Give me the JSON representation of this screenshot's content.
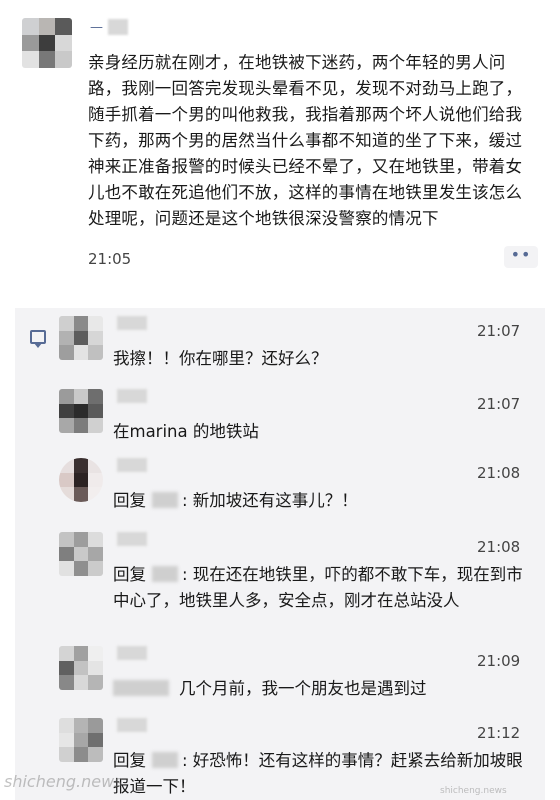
{
  "post": {
    "text": "亲身经历就在刚才，在地铁被下迷药，两个年轻的男人问路，我刚一回答完发现头晕看不见，发现不对劲马上跑了，随手抓着一个男的叫他救我，我指着那两个坏人说他们给我下药，那两个男的居然当什么事都不知道的坐了下来，缓过神来正准备报警的时候头已经不晕了，又在地铁里，带着女儿也不敢在死追他们不放，这样的事情在地铁里发生该怎么处理呢，问题还是这个地铁很深没警察的情况下",
    "time": "21:05",
    "more_label": "••",
    "avatar_colors": [
      "#cfd0d2",
      "#b9b6b3",
      "#5a5a5a",
      "#9a9a9a",
      "#3d3d3d",
      "#d8d8d8",
      "#e2e2e2",
      "#787878",
      "#c9c9c9"
    ]
  },
  "comments": [
    {
      "time": "21:07",
      "text": "我擦！！你在哪里？还好么？",
      "avatar_colors": [
        "#cfcfcf",
        "#8a8a8a",
        "#e8e8e8",
        "#b2b2b2",
        "#5d5d5d",
        "#d6d6d6",
        "#9e9e9e",
        "#e3e3e3",
        "#c0c0c0"
      ]
    },
    {
      "time": "21:07",
      "text": "在marina 的地铁站",
      "avatar_colors": [
        "#9b9b9b",
        "#c9c9c9",
        "#6e6e6e",
        "#404040",
        "#2b2b2b",
        "#5a5a5a",
        "#a8a8a8",
        "#7c7c7c",
        "#d0d0d0"
      ]
    },
    {
      "time": "21:08",
      "text_prefix": "回复",
      "text": ": 新加坡还有这事儿？！",
      "avatar_colors": [
        "#e6dede",
        "#3a2f2f",
        "#e9e3e3",
        "#d9c9c6",
        "#2c2323",
        "#f0ebeb",
        "#e5dcda",
        "#6a5a58",
        "#f2eeee"
      ]
    },
    {
      "time": "21:08",
      "text_prefix": "回复",
      "text": ": 现在还在地铁里，吓的都不敢下车，现在到市中心了，地铁里人多，安全点，刚才在总站没人",
      "avatar_colors": [
        "#c3c3c3",
        "#9d9d9d",
        "#dcdcdc",
        "#7f7f7f",
        "#c9c9c9",
        "#a7a7a7",
        "#e1e1e1",
        "#8f8f8f",
        "#cbcbcb"
      ]
    },
    {
      "time": "21:09",
      "text": "几个月前，我一个朋友也是遇到过",
      "avatar_colors": [
        "#d4d4d4",
        "#a0a0a0",
        "#efefef",
        "#606060",
        "#c2c2c2",
        "#e4e4e4",
        "#888888",
        "#d8d8d8",
        "#b5b5b5"
      ]
    },
    {
      "time": "21:12",
      "text_prefix": "回复",
      "text": ": 好恐怖！还有这样的事情？赶紧去给新加坡眼报道一下！",
      "avatar_colors": [
        "#dedede",
        "#b4b4b4",
        "#9a9a9a",
        "#e6e6e6",
        "#a7a7a7",
        "#6f6f6f",
        "#d0d0d0",
        "#8c8c8c",
        "#bcbcbc"
      ]
    }
  ],
  "watermark": "shicheng.news",
  "watermark_small": "shicheng.news"
}
